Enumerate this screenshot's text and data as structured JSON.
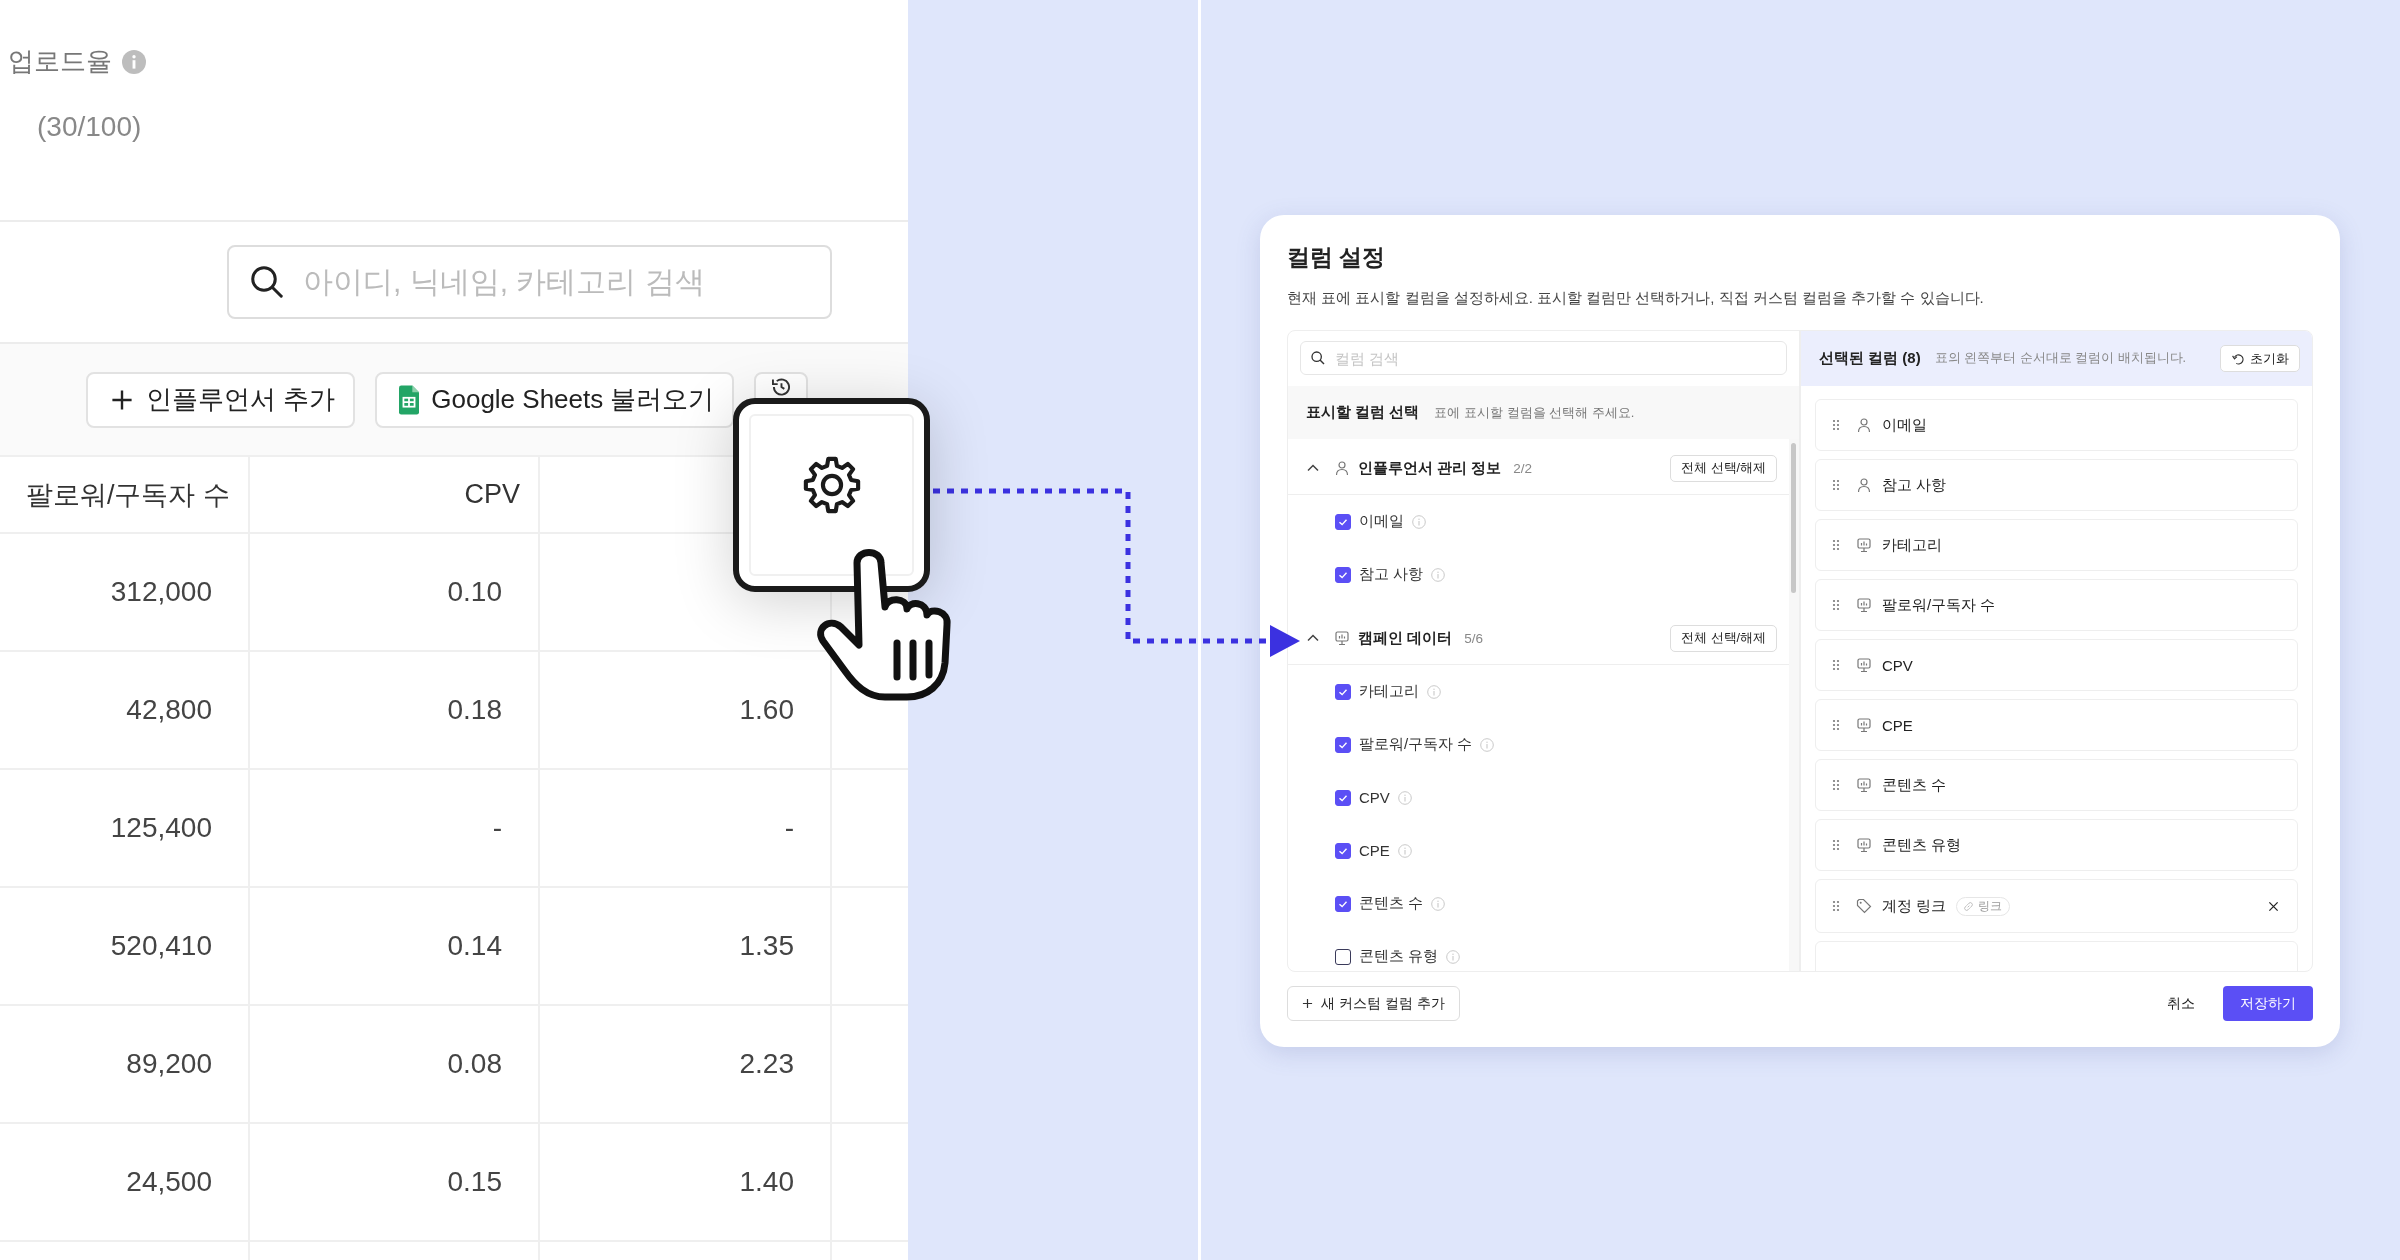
{
  "upload_rate": {
    "label": "업로드율",
    "count": "(30/100)"
  },
  "search": {
    "placeholder": "아이디, 닉네임, 카테고리 검색"
  },
  "toolbar": [
    {
      "kind": "add",
      "label": "인플루언서 추가"
    },
    {
      "kind": "sheets",
      "label": "Google Sheets 불러오기"
    },
    {
      "kind": "history"
    }
  ],
  "table": {
    "columns": [
      "팔로워/구독자 수",
      "CPV"
    ],
    "rows": [
      [
        "312,000",
        "0.10"
      ],
      [
        "42,800",
        "0.18",
        "1.60"
      ],
      [
        "125,400",
        "-",
        "-"
      ],
      [
        "520,410",
        "0.14",
        "1.35"
      ],
      [
        "89,200",
        "0.08",
        "2.23"
      ],
      [
        "24,500",
        "0.15",
        "1.40"
      ]
    ]
  },
  "modal": {
    "title": "컬럼 설정",
    "description": "현재 표에 표시할 컬럼을 설정하세요. 표시할 컬럼만 선택하거나, 직접 커스텀 컬럼을 추가할 수 있습니다.",
    "available": {
      "search_placeholder": "컬럼 검색",
      "heading": "표시할 컬럼 선택",
      "hint": "표에 표시할 컬럼을 선택해 주세요.",
      "groups": [
        {
          "kind": "person",
          "name": "인플루언서 관리 정보",
          "count": "2/2",
          "toggle": "전체 선택/해제",
          "expanded": true,
          "items": [
            {
              "label": "이메일",
              "checked": true
            },
            {
              "label": "참고 사항",
              "checked": true
            }
          ]
        },
        {
          "kind": "campaign",
          "name": "캠페인 데이터",
          "count": "5/6",
          "toggle": "전체 선택/해제",
          "expanded": true,
          "items": [
            {
              "label": "카테고리",
              "checked": true
            },
            {
              "label": "팔로워/구독자 수",
              "checked": true
            },
            {
              "label": "CPV",
              "checked": true
            },
            {
              "label": "CPE",
              "checked": true
            },
            {
              "label": "콘텐츠 수",
              "checked": true
            },
            {
              "label": "콘텐츠 유형",
              "checked": false
            }
          ]
        }
      ]
    },
    "selected": {
      "heading": "선택된 컬럼 (8)",
      "hint": "표의 왼쪽부터 순서대로 컬럼이 배치됩니다.",
      "reset": "초기화",
      "items": [
        {
          "kind": "person",
          "label": "이메일"
        },
        {
          "kind": "person",
          "label": "참고 사항"
        },
        {
          "kind": "campaign",
          "label": "카테고리"
        },
        {
          "kind": "campaign",
          "label": "팔로워/구독자 수"
        },
        {
          "kind": "campaign",
          "label": "CPV"
        },
        {
          "kind": "campaign",
          "label": "CPE"
        },
        {
          "kind": "campaign",
          "label": "콘텐츠 수"
        },
        {
          "kind": "campaign",
          "label": "콘텐츠 유형"
        },
        {
          "kind": "custom",
          "label": "계정 링크",
          "tag": "링크",
          "removable": true
        }
      ]
    },
    "footer": {
      "add_custom": "새 커스텀 컬럼 추가",
      "cancel": "취소",
      "save": "저장하기"
    }
  }
}
